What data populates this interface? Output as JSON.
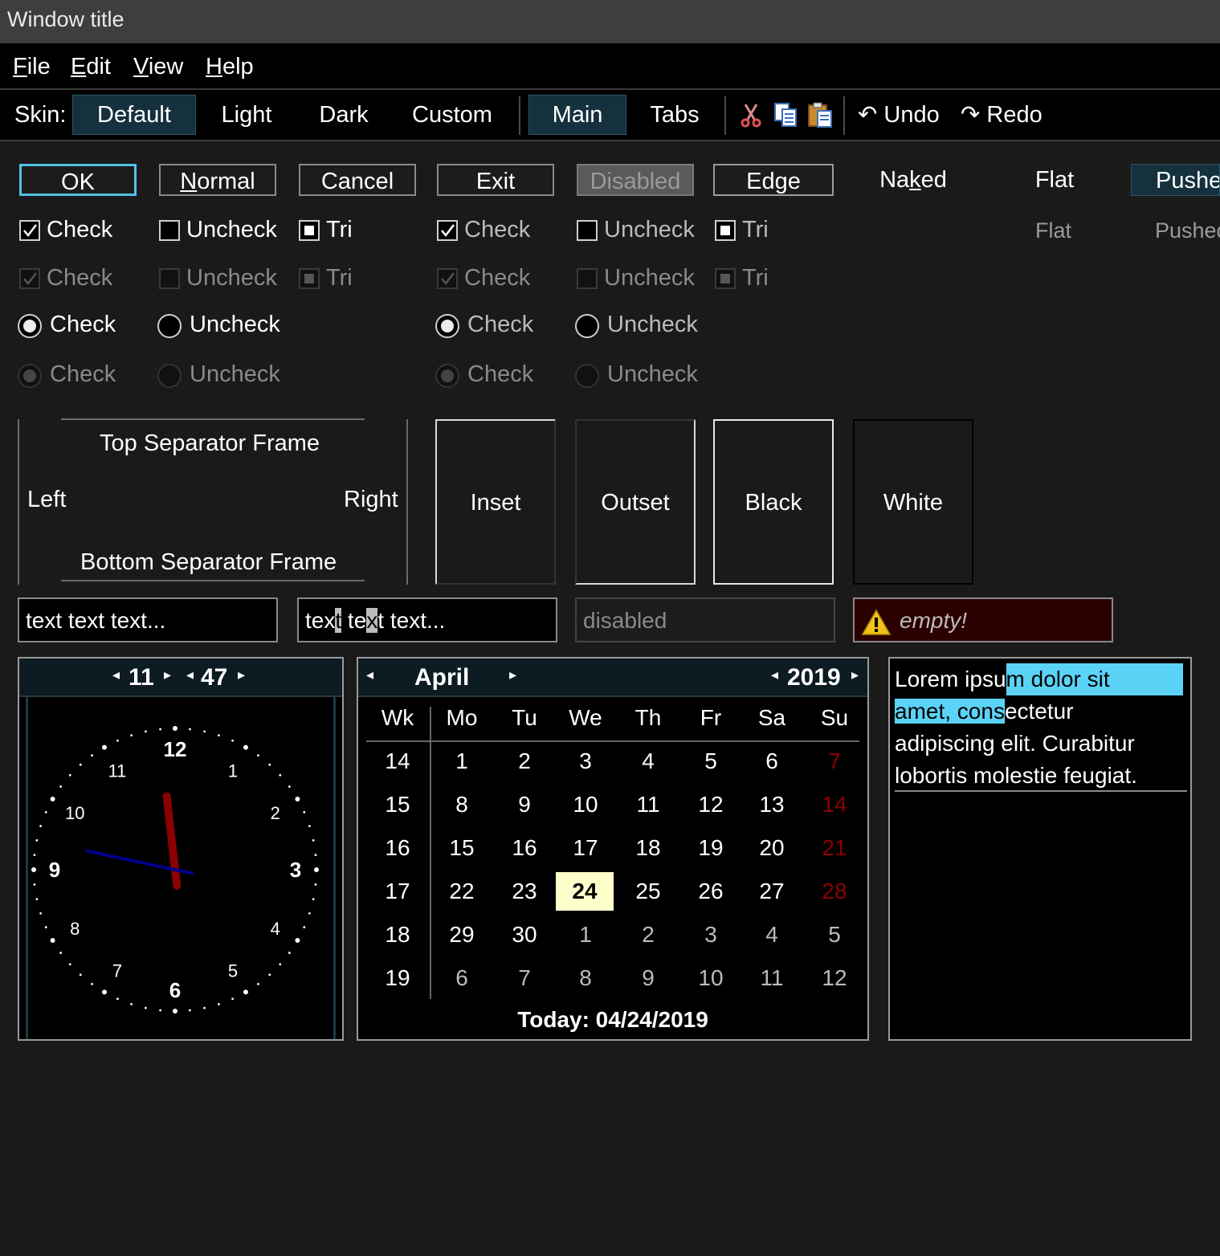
{
  "window": {
    "title": "Window title"
  },
  "menu": [
    {
      "label": "File",
      "accel": "F",
      "rest": "ile"
    },
    {
      "label": "Edit",
      "accel": "E",
      "rest": "dit"
    },
    {
      "label": "View",
      "accel": "V",
      "rest": "iew"
    },
    {
      "label": "Help",
      "accel": "H",
      "rest": "elp"
    }
  ],
  "toolbar": {
    "skin_label": "Skin:",
    "skins": [
      "Default",
      "Light",
      "Dark",
      "Custom"
    ],
    "active_skin": "Default",
    "views": [
      "Main",
      "Tabs"
    ],
    "active_view": "Main",
    "icons": [
      "cut-icon",
      "copy-icon",
      "paste-icon"
    ],
    "undo": "Undo",
    "redo": "Redo"
  },
  "buttons": {
    "ok": "OK",
    "normal": "Normal",
    "cancel": "Cancel",
    "exit": "Exit",
    "disabled": "Disabled",
    "edge": "Edge",
    "naked": "Naked",
    "flat": "Flat",
    "pushed": "Pushed",
    "flat_disabled": "Flat",
    "pushed_disabled": "Pushed"
  },
  "checks": {
    "check": "Check",
    "uncheck": "Uncheck",
    "tri": "Tri"
  },
  "frames": {
    "top": "Top Separator Frame",
    "bottom": "Bottom Separator Frame",
    "left": "Left",
    "right": "Right",
    "inset": "Inset",
    "outset": "Outset",
    "black": "Black",
    "white": "White"
  },
  "inputs": {
    "text1": "text text text...",
    "text2_a": "tex",
    "text2_sel1": "t",
    "text2_b": " te",
    "text2_sel2": "x",
    "text2_c": "t text...",
    "disabled": "disabled",
    "empty": "empty!"
  },
  "clock": {
    "hour": "11",
    "minute": "47",
    "face_numbers": [
      "12",
      "1",
      "2",
      "3",
      "4",
      "5",
      "6",
      "7",
      "8",
      "9",
      "10",
      "11"
    ],
    "hour_hand_color": "#8b0000",
    "minute_hand_color": "#00008b"
  },
  "calendar": {
    "month": "April",
    "year": "2019",
    "headers": [
      "Wk",
      "Mo",
      "Tu",
      "We",
      "Th",
      "Fr",
      "Sa",
      "Su"
    ],
    "weeks": [
      [
        "14",
        "1",
        "2",
        "3",
        "4",
        "5",
        "6",
        "7"
      ],
      [
        "15",
        "8",
        "9",
        "10",
        "11",
        "12",
        "13",
        "14"
      ],
      [
        "16",
        "15",
        "16",
        "17",
        "18",
        "19",
        "20",
        "21"
      ],
      [
        "17",
        "22",
        "23",
        "24",
        "25",
        "26",
        "27",
        "28"
      ],
      [
        "18",
        "29",
        "30",
        "1",
        "2",
        "3",
        "4",
        "5"
      ],
      [
        "19",
        "6",
        "7",
        "8",
        "9",
        "10",
        "11",
        "12"
      ]
    ],
    "selected": "24",
    "today": "Today: 04/24/2019"
  },
  "textview": {
    "pre": "Lorem ipsu",
    "sel": "m dolor sit amet, cons",
    "post": "ectetur adipiscing elit. Curabitur lobortis molestie feugiat.",
    "line1a": "Lorem ipsu",
    "line1b": "m dolor sit",
    "line2a": "amet, cons",
    "line2b": "ectetur",
    "line3": "adipiscing elit. Curabitur",
    "line4": "lobortis molestie feugiat."
  },
  "colors": {
    "accent": "#52c3e6",
    "selection": "#5bd3f6",
    "pushed_bg": "#14313d",
    "weekend_red": "#8b0000",
    "error_bg": "#2a0000",
    "today_bg": "#ffffcc"
  }
}
